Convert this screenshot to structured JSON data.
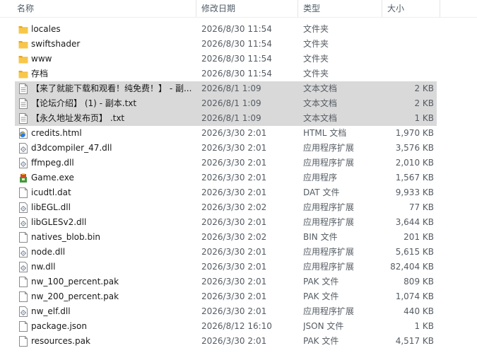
{
  "header": {
    "name": "名称",
    "date": "修改日期",
    "type": "类型",
    "size": "大小",
    "sort_indicator": "^"
  },
  "files": [
    {
      "name": "locales",
      "date": "2026/8/30 11:54",
      "type": "文件夹",
      "size": "",
      "icon": "folder-icon",
      "selected": false
    },
    {
      "name": "swiftshader",
      "date": "2026/8/30 11:54",
      "type": "文件夹",
      "size": "",
      "icon": "folder-icon",
      "selected": false
    },
    {
      "name": "www",
      "date": "2026/8/30 11:54",
      "type": "文件夹",
      "size": "",
      "icon": "folder-icon",
      "selected": false
    },
    {
      "name": "存档",
      "date": "2026/8/30 11:54",
      "type": "文件夹",
      "size": "",
      "icon": "folder-icon",
      "selected": false
    },
    {
      "name": "【来了就能下载和观看！纯免费！】 - 副...",
      "date": "2026/8/1 1:09",
      "type": "文本文档",
      "size": "2 KB",
      "icon": "text-file-icon",
      "selected": true
    },
    {
      "name": "【论坛介绍】 (1) - 副本.txt",
      "date": "2026/8/1 1:09",
      "type": "文本文档",
      "size": "2 KB",
      "icon": "text-file-icon",
      "selected": true
    },
    {
      "name": "【永久地址发布页】 .txt",
      "date": "2026/8/1 1:09",
      "type": "文本文档",
      "size": "1 KB",
      "icon": "text-file-icon",
      "selected": true
    },
    {
      "name": "credits.html",
      "date": "2026/3/30 2:01",
      "type": "HTML 文档",
      "size": "1,970 KB",
      "icon": "html-file-icon",
      "selected": false
    },
    {
      "name": "d3dcompiler_47.dll",
      "date": "2026/3/30 2:01",
      "type": "应用程序扩展",
      "size": "3,576 KB",
      "icon": "dll-file-icon",
      "selected": false
    },
    {
      "name": "ffmpeg.dll",
      "date": "2026/3/30 2:01",
      "type": "应用程序扩展",
      "size": "2,010 KB",
      "icon": "dll-file-icon",
      "selected": false
    },
    {
      "name": "Game.exe",
      "date": "2026/3/30 2:01",
      "type": "应用程序",
      "size": "1,567 KB",
      "icon": "game-exe-icon",
      "selected": false
    },
    {
      "name": "icudtl.dat",
      "date": "2026/3/30 2:01",
      "type": "DAT 文件",
      "size": "9,933 KB",
      "icon": "generic-file-icon",
      "selected": false
    },
    {
      "name": "libEGL.dll",
      "date": "2026/3/30 2:02",
      "type": "应用程序扩展",
      "size": "77 KB",
      "icon": "dll-file-icon",
      "selected": false
    },
    {
      "name": "libGLESv2.dll",
      "date": "2026/3/30 2:01",
      "type": "应用程序扩展",
      "size": "3,644 KB",
      "icon": "dll-file-icon",
      "selected": false
    },
    {
      "name": "natives_blob.bin",
      "date": "2026/3/30 2:02",
      "type": "BIN 文件",
      "size": "201 KB",
      "icon": "generic-file-icon",
      "selected": false
    },
    {
      "name": "node.dll",
      "date": "2026/3/30 2:01",
      "type": "应用程序扩展",
      "size": "5,615 KB",
      "icon": "dll-file-icon",
      "selected": false
    },
    {
      "name": "nw.dll",
      "date": "2026/3/30 2:01",
      "type": "应用程序扩展",
      "size": "82,404 KB",
      "icon": "dll-file-icon",
      "selected": false
    },
    {
      "name": "nw_100_percent.pak",
      "date": "2026/3/30 2:01",
      "type": "PAK 文件",
      "size": "809 KB",
      "icon": "generic-file-icon",
      "selected": false
    },
    {
      "name": "nw_200_percent.pak",
      "date": "2026/3/30 2:01",
      "type": "PAK 文件",
      "size": "1,074 KB",
      "icon": "generic-file-icon",
      "selected": false
    },
    {
      "name": "nw_elf.dll",
      "date": "2026/3/30 2:01",
      "type": "应用程序扩展",
      "size": "440 KB",
      "icon": "dll-file-icon",
      "selected": false
    },
    {
      "name": "package.json",
      "date": "2026/8/12 16:10",
      "type": "JSON 文件",
      "size": "1 KB",
      "icon": "generic-file-icon",
      "selected": false
    },
    {
      "name": "resources.pak",
      "date": "2026/3/30 2:01",
      "type": "PAK 文件",
      "size": "4,517 KB",
      "icon": "generic-file-icon",
      "selected": false
    }
  ],
  "colors": {
    "selection": "#d9d9d9",
    "folder": "#f8c74a",
    "folder_dark": "#e5a823",
    "text_primary": "#1a1a1a",
    "text_secondary": "#555c63"
  }
}
